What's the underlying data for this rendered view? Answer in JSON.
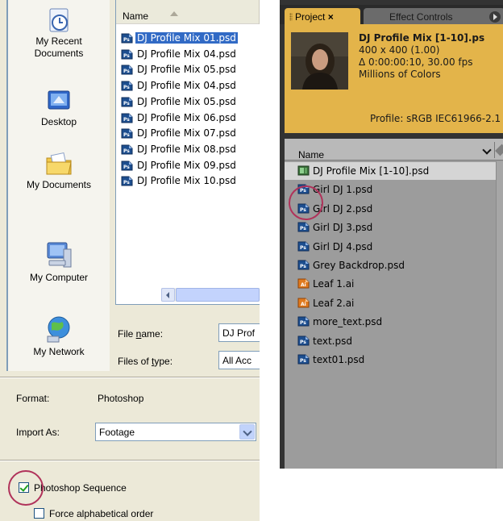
{
  "import_dialog": {
    "places": [
      {
        "label": "My Recent Documents",
        "icon": "recent-documents-icon"
      },
      {
        "label": "Desktop",
        "icon": "desktop-icon"
      },
      {
        "label": "My Documents",
        "icon": "my-documents-icon"
      },
      {
        "label": "My Computer",
        "icon": "my-computer-icon"
      },
      {
        "label": "My Network",
        "icon": "my-network-icon"
      }
    ],
    "file_list": {
      "column_header": "Name",
      "files": [
        "DJ Profile Mix 01.psd",
        "DJ Profile Mix 04.psd",
        "DJ Profile Mix 05.psd",
        "DJ Profile Mix 04.psd",
        "DJ Profile Mix 05.psd",
        "DJ Profile Mix 06.psd",
        "DJ Profile Mix 07.psd",
        "DJ Profile Mix 08.psd",
        "DJ Profile Mix 09.psd",
        "DJ Profile Mix 10.psd"
      ],
      "selected_index": 0
    },
    "file_name": {
      "label_pre": "File ",
      "label_key": "n",
      "label_post": "ame:",
      "value": "DJ Prof"
    },
    "files_of_type": {
      "label_pre": "Files of ",
      "label_key": "t",
      "label_post": "ype:",
      "value": "All Acc"
    },
    "format": {
      "label": "Format:",
      "value": "Photoshop"
    },
    "import_as": {
      "label": "Import As:",
      "value": "Footage"
    },
    "photoshop_sequence": {
      "label": "Photoshop Sequence",
      "checked": true
    },
    "force_alphabetical": {
      "label": "Force alphabetical order",
      "checked": false
    },
    "colors": {
      "selection": "#316ac5",
      "highlight_ring": "#b0325a"
    }
  },
  "project_panel": {
    "tabs": [
      "Project",
      "Effect Controls"
    ],
    "tab_close": "×",
    "selected_item": {
      "name": "DJ Profile Mix [1-10].ps",
      "dimensions": "400 x 400 (1.00)",
      "duration": "Δ 0:00:00:10, 30.00 fps",
      "colors": "Millions of Colors",
      "profile": "Profile: sRGB IEC61966-2.1"
    },
    "column_header": "Name",
    "items": [
      {
        "name": "DJ Profile Mix [1-10].psd",
        "icon": "footage-sequence-icon"
      },
      {
        "name": "Girl DJ 1.psd",
        "icon": "photoshop-file-icon"
      },
      {
        "name": "Girl DJ 2.psd",
        "icon": "photoshop-file-icon"
      },
      {
        "name": "Girl DJ 3.psd",
        "icon": "photoshop-file-icon"
      },
      {
        "name": "Girl DJ 4.psd",
        "icon": "photoshop-file-icon"
      },
      {
        "name": "Grey Backdrop.psd",
        "icon": "photoshop-file-icon"
      },
      {
        "name": "Leaf 1.ai",
        "icon": "illustrator-file-icon"
      },
      {
        "name": "Leaf 2.ai",
        "icon": "illustrator-file-icon"
      },
      {
        "name": "more_text.psd",
        "icon": "photoshop-file-icon"
      },
      {
        "name": "text.psd",
        "icon": "photoshop-file-icon"
      },
      {
        "name": "text01.psd",
        "icon": "photoshop-file-icon"
      }
    ],
    "colors": {
      "active_tab": "#e3b44a",
      "panel_bg": "#9c9c9c"
    }
  }
}
